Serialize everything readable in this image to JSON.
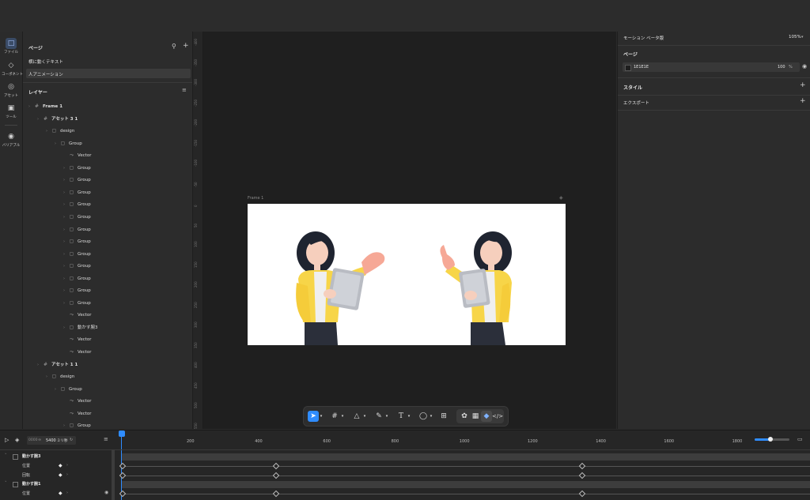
{
  "toolstrip": {
    "items": [
      {
        "label": "ファイル",
        "icon": "file-icon"
      },
      {
        "label": "コーポネント",
        "icon": "component-icon"
      },
      {
        "label": "アセット",
        "icon": "asset-icon"
      },
      {
        "label": "ツール",
        "icon": "toolbox-icon"
      },
      {
        "label": "バリアブル",
        "icon": "variable-icon"
      }
    ]
  },
  "pages": {
    "title": "ページ",
    "items": [
      "横に動くテキスト",
      "人アニメーション"
    ],
    "selected": 1
  },
  "layers": {
    "title": "レイヤー",
    "items": [
      {
        "name": "Frame 1",
        "depth": 0,
        "type": "frame"
      },
      {
        "name": "アセット 3 1",
        "depth": 1,
        "type": "frame"
      },
      {
        "name": "design",
        "depth": 2,
        "type": "group"
      },
      {
        "name": "Group",
        "depth": 3,
        "type": "group"
      },
      {
        "name": "Vector",
        "depth": 4,
        "type": "vector"
      },
      {
        "name": "Group",
        "depth": 4,
        "type": "group"
      },
      {
        "name": "Group",
        "depth": 4,
        "type": "group"
      },
      {
        "name": "Group",
        "depth": 4,
        "type": "group"
      },
      {
        "name": "Group",
        "depth": 4,
        "type": "group"
      },
      {
        "name": "Group",
        "depth": 4,
        "type": "group"
      },
      {
        "name": "Group",
        "depth": 4,
        "type": "group"
      },
      {
        "name": "Group",
        "depth": 4,
        "type": "group"
      },
      {
        "name": "Group",
        "depth": 4,
        "type": "group"
      },
      {
        "name": "Group",
        "depth": 4,
        "type": "group"
      },
      {
        "name": "Group",
        "depth": 4,
        "type": "group"
      },
      {
        "name": "Group",
        "depth": 4,
        "type": "group"
      },
      {
        "name": "Group",
        "depth": 4,
        "type": "group"
      },
      {
        "name": "Vector",
        "depth": 4,
        "type": "vector"
      },
      {
        "name": "動かす腕3",
        "depth": 4,
        "type": "group"
      },
      {
        "name": "Vector",
        "depth": 4,
        "type": "vector"
      },
      {
        "name": "Vector",
        "depth": 4,
        "type": "vector"
      },
      {
        "name": "アセット 1 1",
        "depth": 1,
        "type": "frame"
      },
      {
        "name": "design",
        "depth": 2,
        "type": "group"
      },
      {
        "name": "Group",
        "depth": 3,
        "type": "group"
      },
      {
        "name": "Vector",
        "depth": 4,
        "type": "vector"
      },
      {
        "name": "Vector",
        "depth": 4,
        "type": "vector"
      },
      {
        "name": "Group",
        "depth": 4,
        "type": "group"
      }
    ]
  },
  "ruler": {
    "ticks": [
      "-400",
      "-350",
      "-300",
      "-250",
      "-200",
      "-150",
      "-100",
      "-50",
      "0",
      "50",
      "100",
      "150",
      "200",
      "250",
      "300",
      "350",
      "400",
      "450",
      "500",
      "550"
    ]
  },
  "canvas": {
    "frame_label": "Frame 1",
    "frame_fill": "#ffffff",
    "canvas_bg": "#1e1e1e"
  },
  "toolbar": {
    "tools": [
      "move-tool-icon",
      "frame-tool-icon",
      "shape-tool-icon",
      "pen-tool-icon",
      "text-tool-icon",
      "comment-tool-icon",
      "resources-icon"
    ],
    "modes": [
      "draw-mode-icon",
      "design-mode-icon",
      "prototype-mode-icon",
      "dev-mode-icon"
    ]
  },
  "right": {
    "tabs": "モーション ベータ版",
    "zoom": "105%",
    "page_section": "ページ",
    "page_color": "1E1E1E",
    "page_opacity": "100",
    "page_opacity_unit": "%",
    "style_section": "スタイル",
    "export_section": "エクスポート"
  },
  "timeline": {
    "time_current": "0000",
    "time_total": "5400",
    "time_unit": "ミリ秒",
    "ticks": [
      "200",
      "400",
      "600",
      "800",
      "1000",
      "1200",
      "1400",
      "1600",
      "1800"
    ],
    "tracks": [
      {
        "name": "動かす腕3",
        "kind": "layer"
      },
      {
        "name": "位置",
        "kind": "property"
      },
      {
        "name": "回転",
        "kind": "property"
      },
      {
        "name": "動かす腕1",
        "kind": "layer"
      },
      {
        "name": "位置",
        "kind": "property"
      }
    ],
    "accent": "#2f8cff"
  }
}
